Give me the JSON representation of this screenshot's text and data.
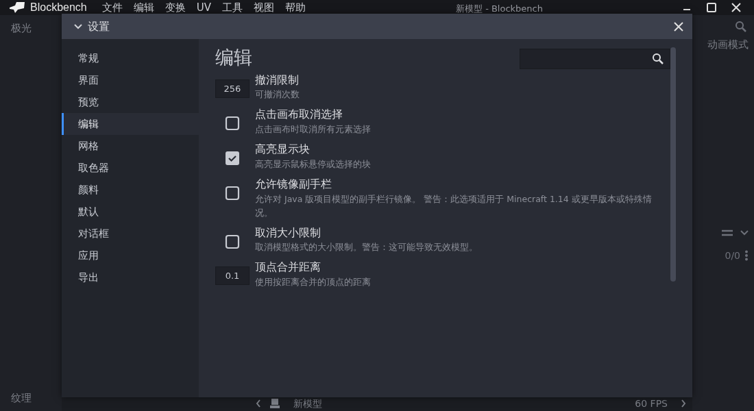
{
  "window": {
    "app_name": "Blockbench",
    "menu": [
      "文件",
      "编辑",
      "变换",
      "UV",
      "工具",
      "视图",
      "帮助"
    ],
    "title": "新模型 - Blockbench"
  },
  "background": {
    "left_panel": {
      "top_tab": "极光",
      "bottom_tab": "纹理"
    },
    "right_panel": {
      "mode_tab": "动画模式",
      "counter": "0/0"
    },
    "status_bar": {
      "file": "新模型",
      "fps": "60 FPS"
    }
  },
  "dialog": {
    "title": "设置",
    "categories": [
      {
        "label": "常规",
        "selected": false
      },
      {
        "label": "界面",
        "selected": false
      },
      {
        "label": "预览",
        "selected": false
      },
      {
        "label": "编辑",
        "selected": true
      },
      {
        "label": "网格",
        "selected": false
      },
      {
        "label": "取色器",
        "selected": false
      },
      {
        "label": "颜料",
        "selected": false
      },
      {
        "label": "默认",
        "selected": false
      },
      {
        "label": "对话框",
        "selected": false
      },
      {
        "label": "应用",
        "selected": false
      },
      {
        "label": "导出",
        "selected": false
      }
    ],
    "section_title": "编辑",
    "settings": [
      {
        "kind": "number",
        "value": "256",
        "name": "撤消限制",
        "description": "可撤消次数"
      },
      {
        "kind": "checkbox",
        "checked": false,
        "name": "点击画布取消选择",
        "description": "点击画布时取消所有元素选择"
      },
      {
        "kind": "checkbox",
        "checked": true,
        "name": "高亮显示块",
        "description": "高亮显示鼠标悬停或选择的块"
      },
      {
        "kind": "checkbox",
        "checked": false,
        "name": "允许镜像副手栏",
        "description": "允许对 Java 版项目模型的副手栏行镜像。 警告：此选项适用于 Minecraft 1.14 或更早版本或特殊情况。"
      },
      {
        "kind": "checkbox",
        "checked": false,
        "name": "取消大小限制",
        "description": "取消模型格式的大小限制。警告：这可能导致无效模型。"
      },
      {
        "kind": "number",
        "value": "0.1",
        "name": "顶点合并距离",
        "description": "使用按距离合并的顶点的距离"
      }
    ]
  }
}
